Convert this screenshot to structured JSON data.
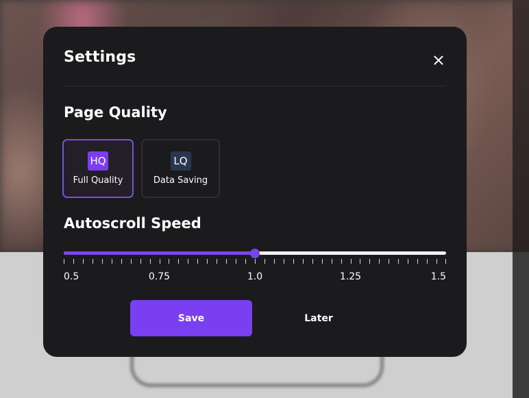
{
  "modal": {
    "title": "Settings",
    "close_icon": "close-icon"
  },
  "page_quality": {
    "title": "Page Quality",
    "options": [
      {
        "badge": "HQ",
        "label": "Full Quality",
        "selected": true,
        "badge_color": "#7c3df0"
      },
      {
        "badge": "LQ",
        "label": "Data Saving",
        "selected": false,
        "badge_color": "#2a3550"
      }
    ]
  },
  "autoscroll": {
    "title": "Autoscroll Speed",
    "min": 0.5,
    "max": 1.5,
    "value": 1.0,
    "tick_count": 41,
    "labels": [
      "0.5",
      "0.75",
      "1.0",
      "1.25",
      "1.5"
    ]
  },
  "actions": {
    "save_label": "Save",
    "later_label": "Later"
  },
  "colors": {
    "accent": "#7a3ff0",
    "modal_bg": "#1b1b1e"
  }
}
